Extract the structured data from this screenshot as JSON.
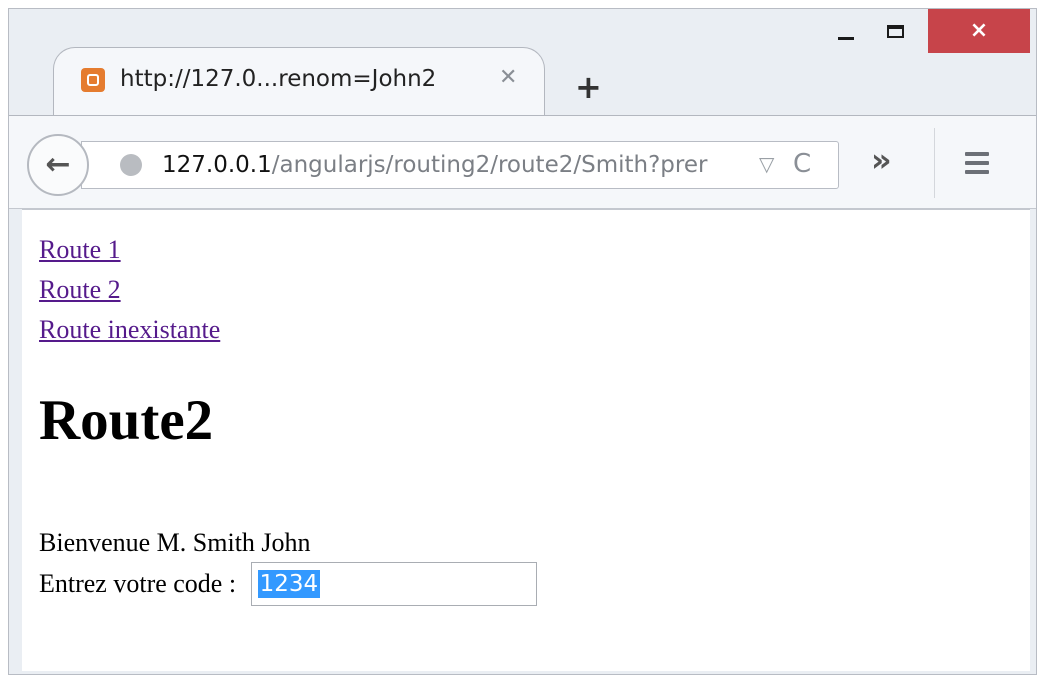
{
  "window": {
    "minimize_label": "_",
    "maximize_label": "",
    "close_label": "×"
  },
  "tab": {
    "title": "http://127.0...renom=John2",
    "close_label": "✕",
    "new_tab_label": "+"
  },
  "navbar": {
    "back_label": "←",
    "url_host": "127.0.0.1",
    "url_path": "/angularjs/routing2/route2/Smith?prer",
    "dropdown_label": "▽",
    "reload_label": "C",
    "overflow_label": "»"
  },
  "page": {
    "links": [
      "Route 1",
      "Route 2",
      "Route inexistante"
    ],
    "heading": "Route2",
    "welcome": "Bienvenue M. Smith John",
    "code_label": "Entrez votre code :",
    "code_value": "1234"
  }
}
